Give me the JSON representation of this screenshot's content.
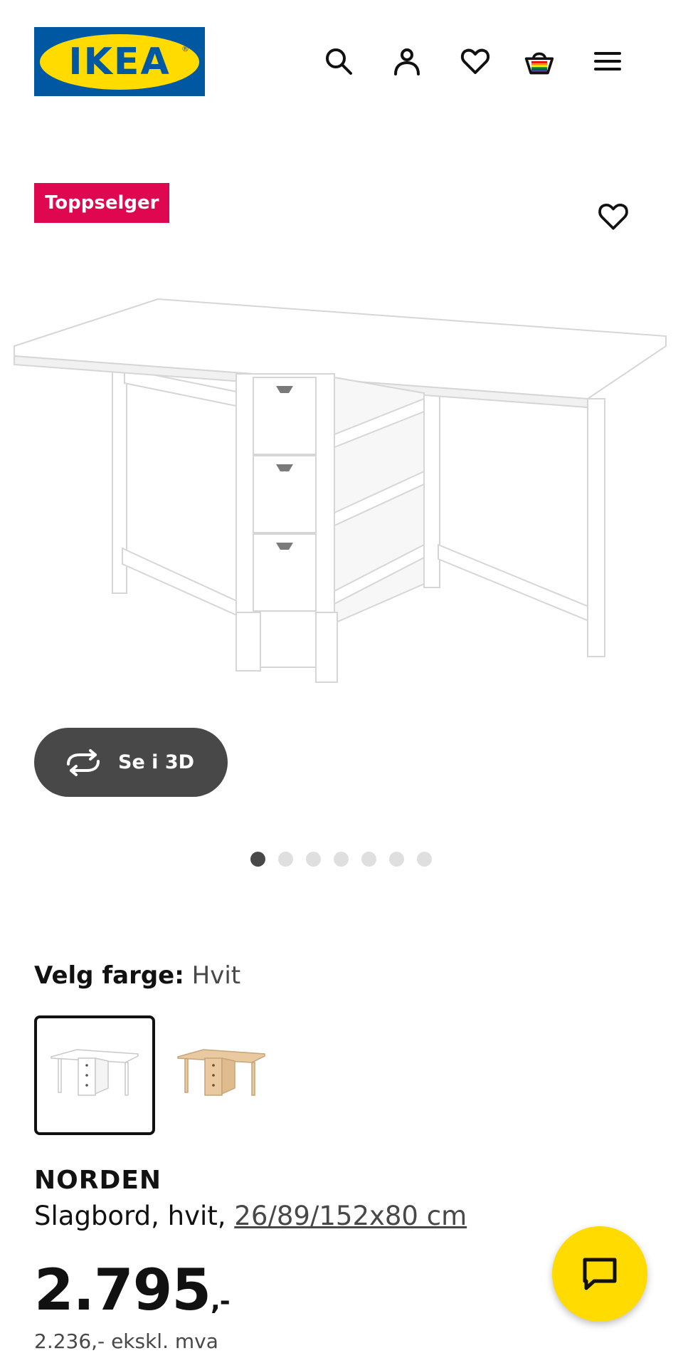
{
  "header": {
    "logo_text": "IKEA",
    "logo_reg": "®",
    "icons": [
      "search-icon",
      "account-icon",
      "favourites-icon",
      "basket-icon",
      "menu-icon"
    ]
  },
  "product": {
    "badge": "Toppselger",
    "image_icon": "folding-table-image",
    "view_3d_label": "Se i 3D",
    "gallery": {
      "count": 7,
      "active_index": 1
    },
    "color_label": "Velg farge:",
    "color_value": "Hvit",
    "swatches": [
      {
        "name": "Hvit",
        "selected": true
      },
      {
        "name": "Bjørk",
        "selected": false
      }
    ],
    "name": "NORDEN",
    "description": "Slagbord, hvit, ",
    "measure": "26/89/152x80 cm",
    "price_main": "2.795",
    "price_suffix": ",-",
    "price_ex_vat": "2.236,- ekskl. mva"
  },
  "colors": {
    "brand_blue": "#0058a3",
    "brand_yellow": "#ffdb00",
    "badge_red": "#e00751",
    "dark_button": "#484848"
  }
}
